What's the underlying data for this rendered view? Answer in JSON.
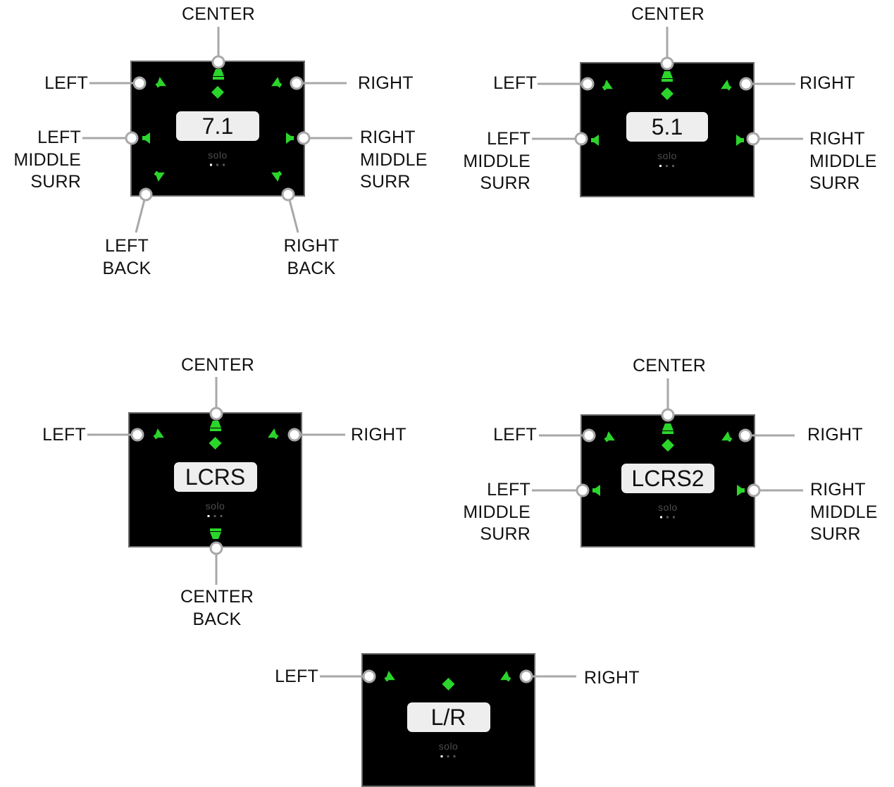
{
  "colors": {
    "panel_bg": "#000000",
    "panel_border": "#6a6a6a",
    "speaker_green": "#2bd62b",
    "callout_gray": "#a8a8a8",
    "badge_bg": "#eeeeee"
  },
  "panels": [
    {
      "id": "7.1",
      "badge": "7.1",
      "logo": "solo",
      "labels": {
        "center": "CENTER",
        "left": "LEFT",
        "right": "RIGHT",
        "left_middle_surr": "LEFT\nMIDDLE\nSURR",
        "right_middle_surr": "RIGHT\nMIDDLE\nSURR",
        "left_back": "LEFT\nBACK",
        "right_back": "RIGHT\nBACK"
      }
    },
    {
      "id": "5.1",
      "badge": "5.1",
      "logo": "solo",
      "labels": {
        "center": "CENTER",
        "left": "LEFT",
        "right": "RIGHT",
        "left_middle_surr": "LEFT\nMIDDLE\nSURR",
        "right_middle_surr": "RIGHT\nMIDDLE\nSURR"
      }
    },
    {
      "id": "LCRS",
      "badge": "LCRS",
      "logo": "solo",
      "labels": {
        "center": "CENTER",
        "left": "LEFT",
        "right": "RIGHT",
        "center_back": "CENTER\nBACK"
      }
    },
    {
      "id": "LCRS2",
      "badge": "LCRS2",
      "logo": "solo",
      "labels": {
        "center": "CENTER",
        "left": "LEFT",
        "right": "RIGHT",
        "left_middle_surr": "LEFT\nMIDDLE\nSURR",
        "right_middle_surr": "RIGHT\nMIDDLE\nSURR"
      }
    },
    {
      "id": "L/R",
      "badge": "L/R",
      "logo": "solo",
      "labels": {
        "left": "LEFT",
        "right": "RIGHT"
      }
    }
  ]
}
